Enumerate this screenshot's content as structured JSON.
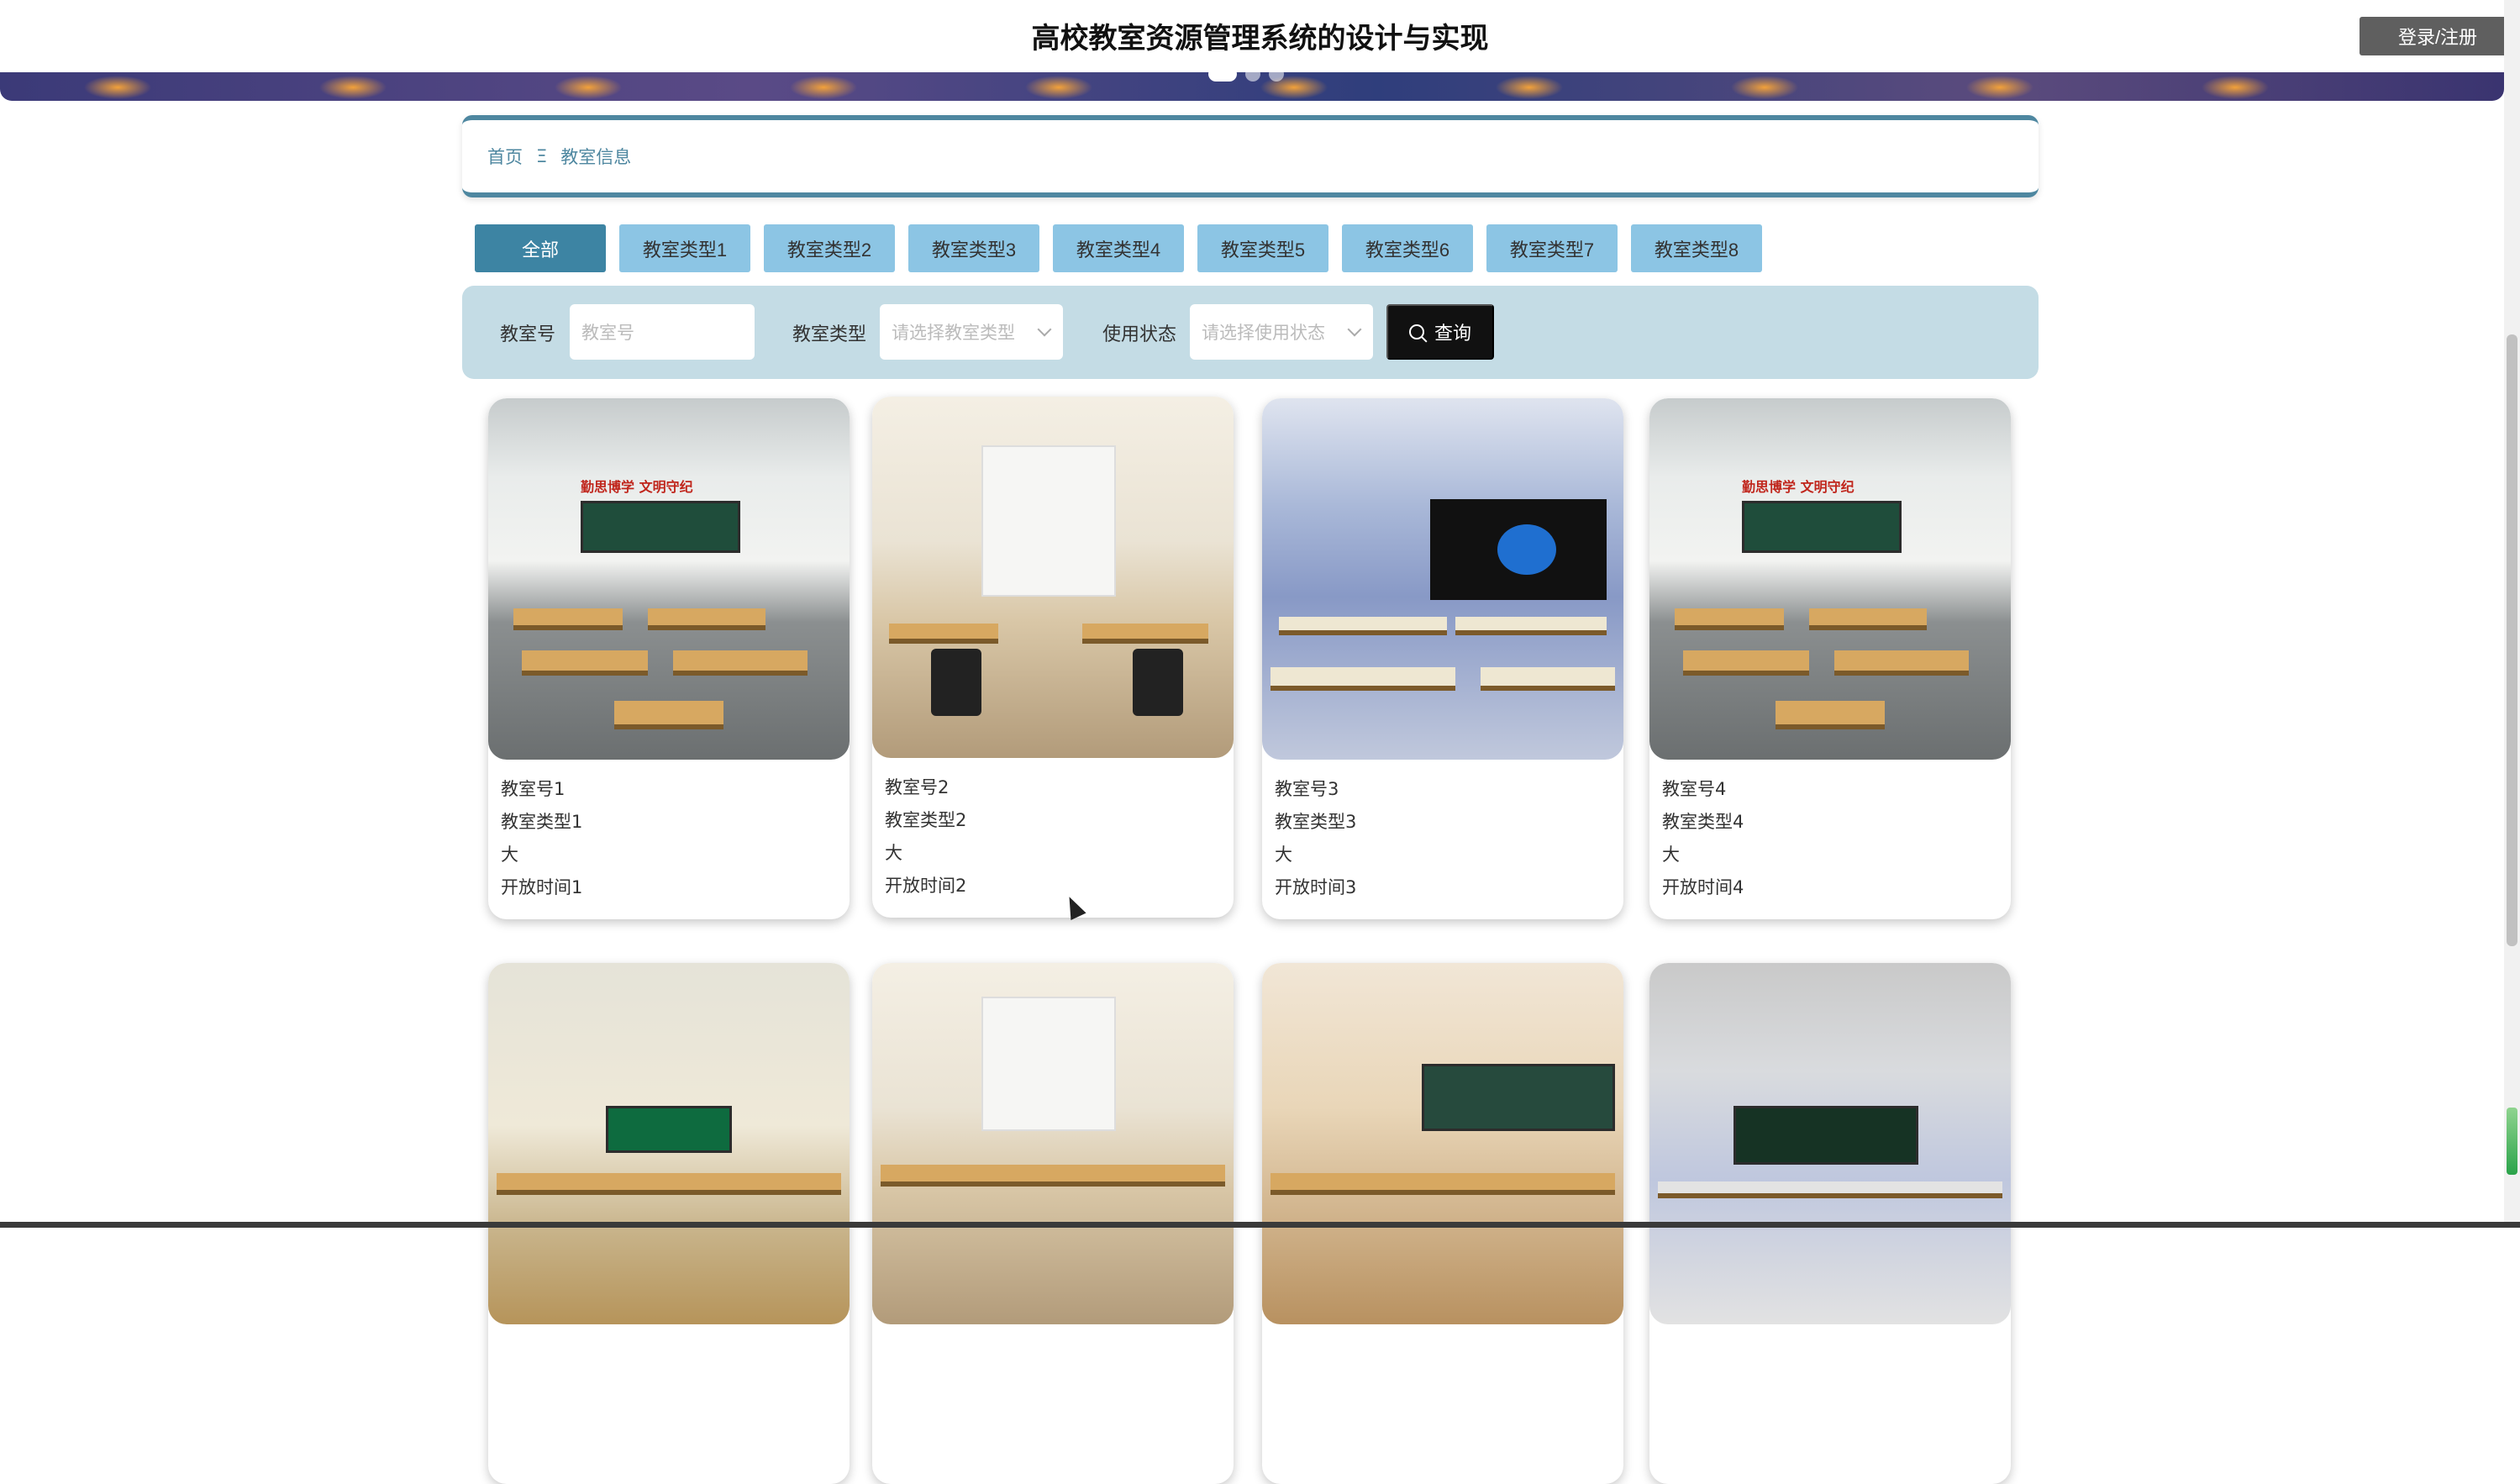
{
  "header": {
    "title": "高校教室资源管理系统的设计与实现",
    "login_label": "登录/注册"
  },
  "banner": {
    "slides": 3,
    "active_slide": 1
  },
  "breadcrumb": {
    "home": "首页",
    "separator": "Ξ",
    "current": "教室信息"
  },
  "tabs": [
    {
      "label": "全部",
      "active": true
    },
    {
      "label": "教室类型1",
      "active": false
    },
    {
      "label": "教室类型2",
      "active": false
    },
    {
      "label": "教室类型3",
      "active": false
    },
    {
      "label": "教室类型4",
      "active": false
    },
    {
      "label": "教室类型5",
      "active": false
    },
    {
      "label": "教室类型6",
      "active": false
    },
    {
      "label": "教室类型7",
      "active": false
    },
    {
      "label": "教室类型8",
      "active": false
    }
  ],
  "search": {
    "room_no_label": "教室号",
    "room_no_placeholder": "教室号",
    "room_type_label": "教室类型",
    "room_type_placeholder": "请选择教室类型",
    "status_label": "使用状态",
    "status_placeholder": "请选择使用状态",
    "query_label": "查询"
  },
  "rooms": [
    {
      "room_no": "教室号1",
      "type": "教室类型1",
      "size": "大",
      "open_time": "开放时间1",
      "slogan": "勤思博学 文明守纪"
    },
    {
      "room_no": "教室号2",
      "type": "教室类型2",
      "size": "大",
      "open_time": "开放时间2"
    },
    {
      "room_no": "教室号3",
      "type": "教室类型3",
      "size": "大",
      "open_time": "开放时间3"
    },
    {
      "room_no": "教室号4",
      "type": "教室类型4",
      "size": "大",
      "open_time": "开放时间4",
      "slogan": "勤思博学 文明守纪"
    }
  ],
  "colors": {
    "accent": "#3d84a3",
    "tab": "#8cc5e4",
    "search_bg": "#c4dce5",
    "query_btn": "#111111",
    "login_btn": "#5f5f5f"
  }
}
